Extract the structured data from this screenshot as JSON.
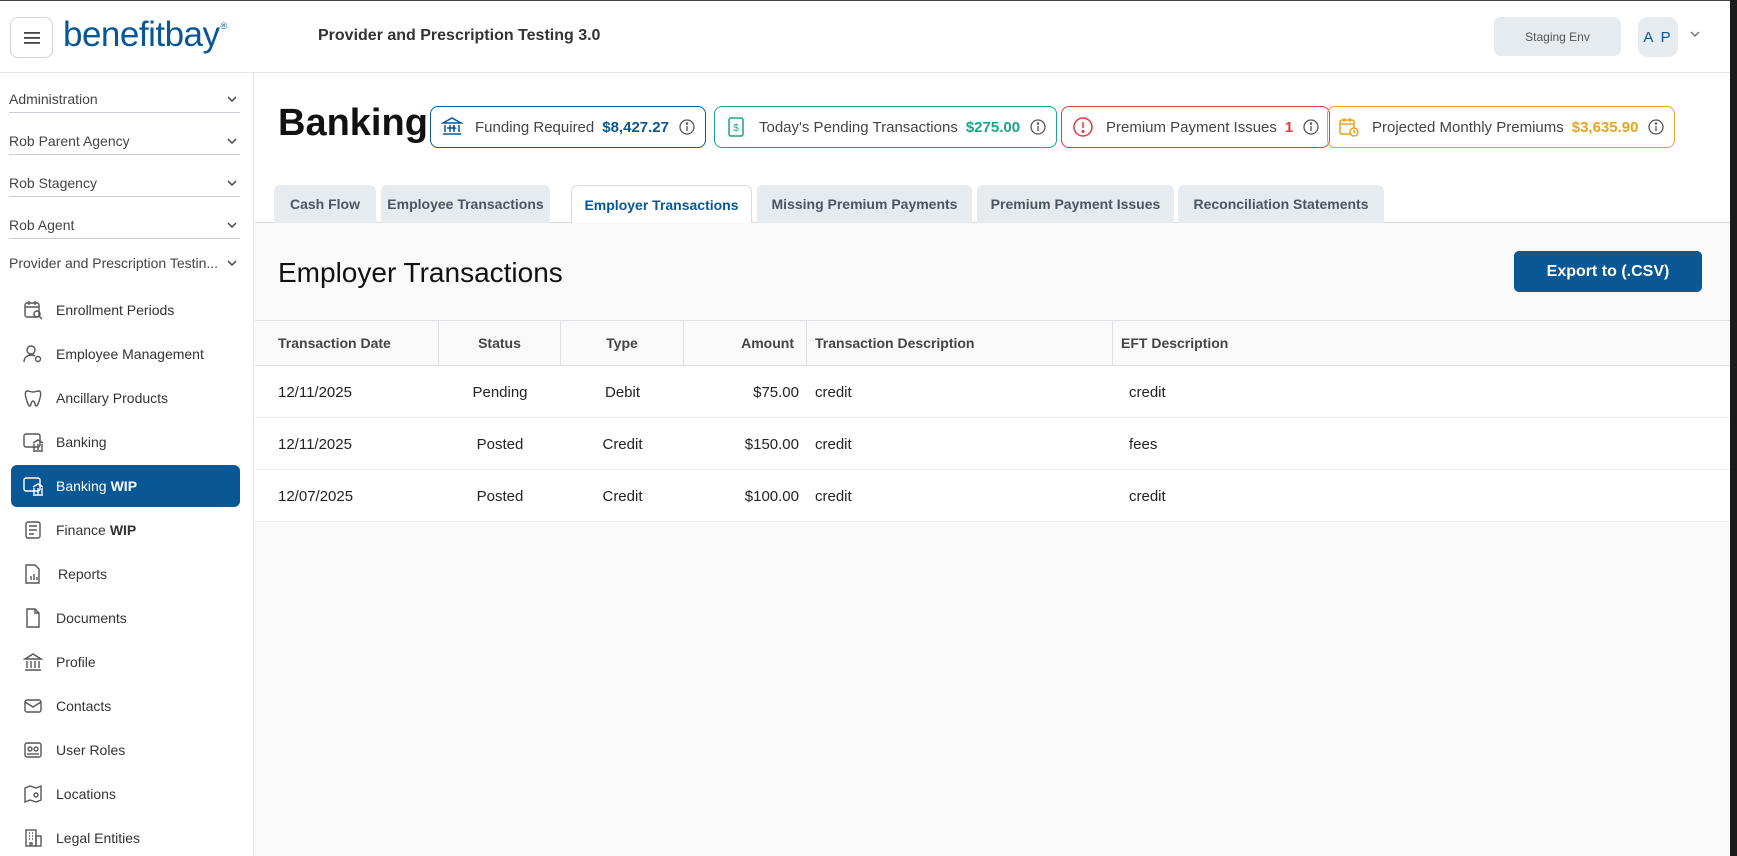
{
  "header": {
    "logo_text": "benefitbay",
    "logo_mark": "®",
    "app_title": "Provider and Prescription Testing 3.0",
    "env_label": "Staging Env",
    "avatar_initials": "A P"
  },
  "sidebar": {
    "selectors": [
      {
        "label": "Administration"
      },
      {
        "label": "Rob Parent Agency"
      },
      {
        "label": "Rob Stagency"
      },
      {
        "label": "Rob Agent"
      },
      {
        "label": "Provider and Prescription Testin..."
      }
    ],
    "items": [
      {
        "label": "Enrollment Periods",
        "icon": "calendar-search-icon"
      },
      {
        "label": "Employee Management",
        "icon": "user-gear-icon"
      },
      {
        "label": "Ancillary Products",
        "icon": "tooth-icon"
      },
      {
        "label": "Banking",
        "icon": "bank-icon"
      },
      {
        "label": "Banking",
        "suffix": "WIP",
        "icon": "bank-icon",
        "active": true
      },
      {
        "label": "Finance",
        "suffix": "WIP",
        "icon": "ledger-icon"
      },
      {
        "label": "Reports",
        "icon": "report-icon"
      },
      {
        "label": "Documents",
        "icon": "document-icon"
      },
      {
        "label": "Profile",
        "icon": "building-icon"
      },
      {
        "label": "Contacts",
        "icon": "envelope-icon"
      },
      {
        "label": "User Roles",
        "icon": "id-card-icon"
      },
      {
        "label": "Locations",
        "icon": "map-pin-icon"
      },
      {
        "label": "Legal Entities",
        "icon": "office-building-icon"
      }
    ]
  },
  "page": {
    "title": "Banking",
    "summary": [
      {
        "label": "Funding Required",
        "value": "$8,427.27",
        "color": "#0a5796",
        "icon": "bank-transfer-icon"
      },
      {
        "label": "Today's Pending Transactions",
        "value": "$275.00",
        "color": "#17a589",
        "icon": "dollar-doc-icon"
      },
      {
        "label": "Premium Payment Issues",
        "value": "1",
        "color": "#e0393e",
        "icon": "alert-circle-icon"
      },
      {
        "label": "Projected Monthly Premiums",
        "value": "$3,635.90",
        "color": "#e7a41f",
        "icon": "calendar-clock-icon"
      }
    ],
    "tabs": [
      {
        "label": "Cash Flow"
      },
      {
        "label": "Employee Transactions"
      },
      {
        "label": "Employer Transactions",
        "active": true
      },
      {
        "label": "Missing Premium Payments"
      },
      {
        "label": "Premium Payment Issues"
      },
      {
        "label": "Reconciliation Statements"
      }
    ],
    "section_title": "Employer Transactions",
    "export_label": "Export to (.CSV)"
  },
  "table": {
    "columns": [
      "Transaction Date",
      "Status",
      "Type",
      "Amount",
      "Transaction Description",
      "EFT Description"
    ],
    "rows": [
      [
        "12/11/2025",
        "Pending",
        "Debit",
        "$75.00",
        "credit",
        "credit"
      ],
      [
        "12/11/2025",
        "Posted",
        "Credit",
        "$150.00",
        "credit",
        "fees"
      ],
      [
        "12/07/2025",
        "Posted",
        "Credit",
        "$100.00",
        "credit",
        "credit"
      ]
    ]
  }
}
